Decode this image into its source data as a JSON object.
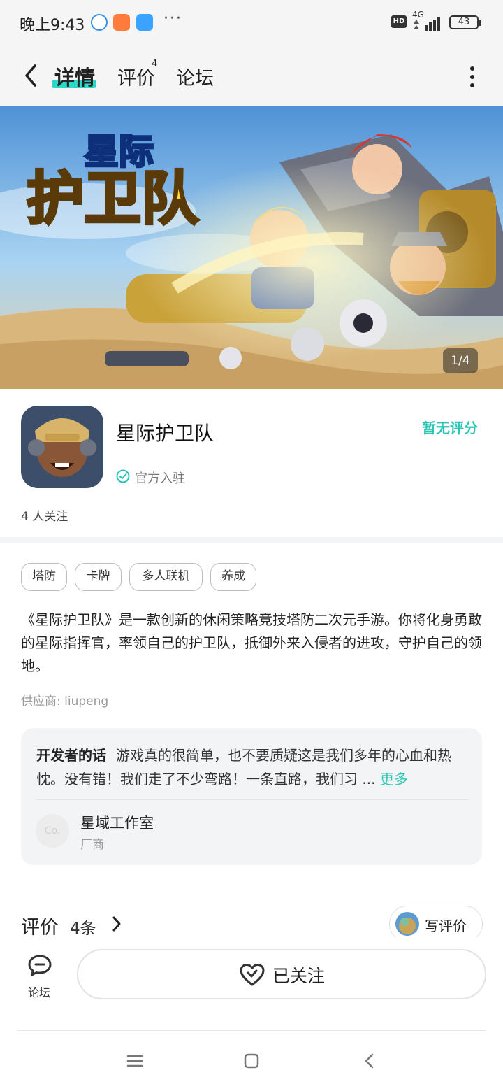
{
  "status_bar": {
    "time": "晚上9:43",
    "network": "4G",
    "hd_badge": "HD",
    "battery": "43",
    "overflow": "···"
  },
  "nav": {
    "back_icon": "back-arrow-icon",
    "tabs": [
      {
        "label": "详情",
        "active": true
      },
      {
        "label": "评价",
        "badge": "4"
      },
      {
        "label": "论坛"
      }
    ],
    "more_icon": "more-vertical-icon"
  },
  "banner": {
    "counter": "1/4",
    "logo_line1": "星际",
    "logo_line2": "护卫队"
  },
  "app": {
    "name": "星际护卫队",
    "verified": "官方入驻",
    "rating": "暂无评分",
    "followers": "4 人关注"
  },
  "tags": [
    "塔防",
    "卡牌",
    "多人联机",
    "养成"
  ],
  "description": "《星际护卫队》是一款创新的休闲策略竞技塔防二次元手游。你将化身勇敢的星际指挥官，率领自己的护卫队，抵御外来入侵者的进攻，守护自己的领地。",
  "supplier": "供应商: liupeng",
  "developer": {
    "label": "开发者的话",
    "text": "游戏真的很简单，也不要质疑这是我们多年的心血和热忱。没有错！我们走了不少弯路！一条直路，我们习 ...",
    "more": "更多",
    "avatar_text": "Co.",
    "name": "星域工作室",
    "role": "厂商"
  },
  "reviews": {
    "title": "评价",
    "count": "4条",
    "write_label": "写评价"
  },
  "action_bar": {
    "forum_label": "论坛",
    "follow_label": "已关注"
  },
  "colors": {
    "accent": "#2ed8c9",
    "accent_text": "#2bc5b4",
    "background": "#f5f5f5"
  }
}
